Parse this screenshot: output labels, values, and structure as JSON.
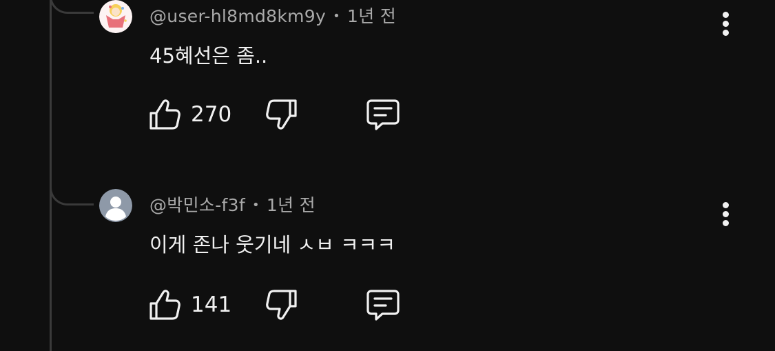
{
  "comments": [
    {
      "handle": "@user-hl8md8km9y",
      "time": "1년 전",
      "text": "45혜선은 좀..",
      "likes": "270",
      "avatar_icon": "cartoon-character-avatar"
    },
    {
      "handle": "@박민소-f3f",
      "time": "1년 전",
      "text": "이게 존나 웃기네 ㅅㅂ ㅋㅋㅋ",
      "likes": "141",
      "avatar_icon": "default-user-avatar"
    }
  ],
  "separator": "•",
  "colors": {
    "background": "#0f0f0f",
    "thread_line": "#3a3a3a",
    "meta_text": "#aaaaaa",
    "primary_text": "#f1f1f1"
  }
}
